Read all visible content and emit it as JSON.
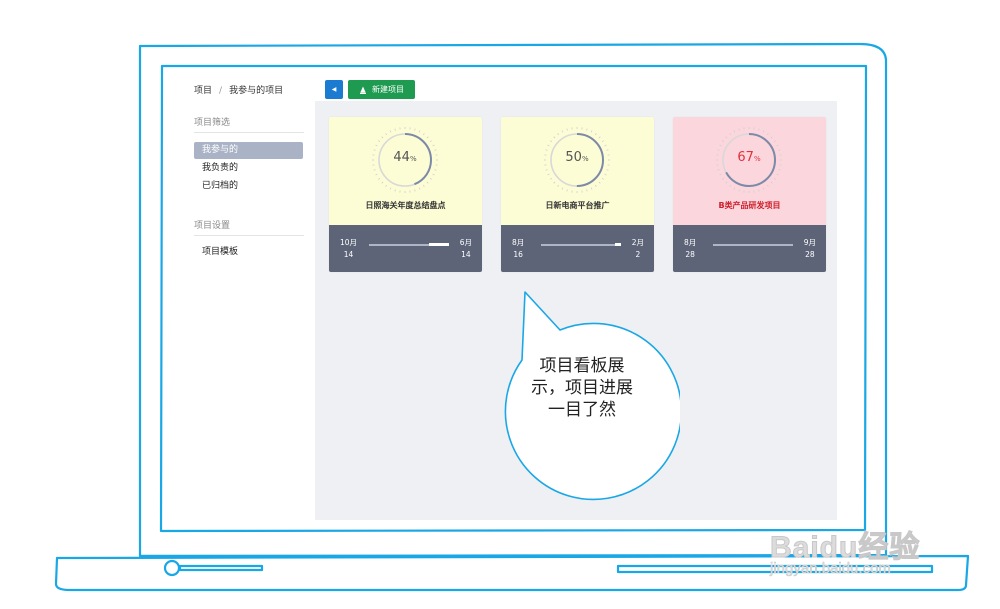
{
  "breadcrumb": {
    "root": "项目",
    "separator": "/",
    "current": "我参与的项目"
  },
  "sidebar": {
    "filter_title": "项目筛选",
    "filter_items": [
      {
        "label": "我参与的",
        "active": true
      },
      {
        "label": "我负责的",
        "active": false
      },
      {
        "label": "已归档的",
        "active": false
      }
    ],
    "settings_title": "项目设置",
    "settings_items": [
      {
        "label": "项目模板"
      }
    ]
  },
  "toolbar": {
    "back_icon": "caret-left-icon",
    "new_project_icon": "person-icon",
    "new_project_label": "新建项目"
  },
  "cards": [
    {
      "percent": 44,
      "percent_unit": "%",
      "title": "日照海关年度总结盘点",
      "start_month": "10月",
      "start_day": "14",
      "end_month": "6月",
      "end_day": "14",
      "bg": "#fcfcd5",
      "accent": "#7c8aa8",
      "text_color": "#555555",
      "title_color": "#333333",
      "timeline_fill": 0.25
    },
    {
      "percent": 50,
      "percent_unit": "%",
      "title": "日新电商平台推广",
      "start_month": "8月",
      "start_day": "16",
      "end_month": "2月",
      "end_day": "2",
      "bg": "#fcfcd5",
      "accent": "#7c8aa8",
      "text_color": "#555555",
      "title_color": "#333333",
      "timeline_fill": 0.08
    },
    {
      "percent": 67,
      "percent_unit": "%",
      "title": "B类产品研发项目",
      "start_month": "8月",
      "start_day": "28",
      "end_month": "9月",
      "end_day": "28",
      "bg": "#fbd6dc",
      "accent": "#7c8aa8",
      "text_color": "#e0313d",
      "title_color": "#cc1f2b",
      "timeline_fill": 0
    }
  ],
  "bubble": {
    "text": "项目看板展\n示，项目进展\n一目了然"
  },
  "watermark": {
    "logo": "Baidu经验",
    "url": "jingyan.baidu.com"
  },
  "colors": {
    "laptop_outline": "#19a7e6",
    "bubble_outline": "#19a7e6",
    "main_bg": "#eef0f4"
  }
}
